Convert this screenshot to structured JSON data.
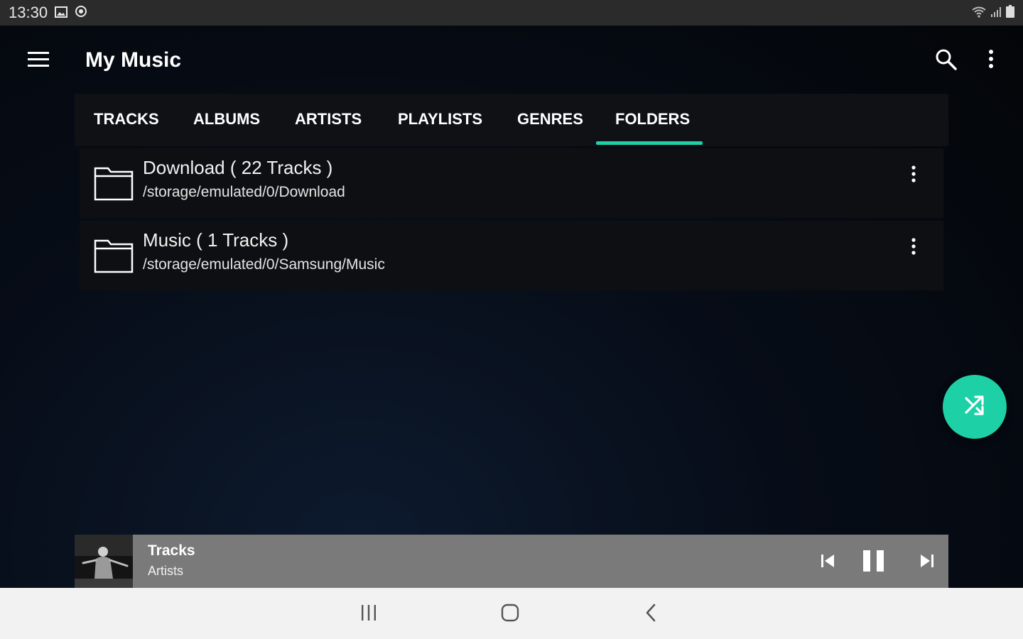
{
  "status_bar": {
    "time": "13:30",
    "left_icons": [
      "gallery-icon",
      "sync-icon"
    ],
    "right_icons": [
      "wifi-icon",
      "signal-icon",
      "battery-icon"
    ]
  },
  "app_bar": {
    "title": "My Music",
    "icons": [
      "menu-icon",
      "search-icon",
      "more-vertical-icon"
    ]
  },
  "tabs": [
    {
      "label": "TRACKS"
    },
    {
      "label": "ALBUMS"
    },
    {
      "label": "ARTISTS"
    },
    {
      "label": "PLAYLISTS"
    },
    {
      "label": "GENRES"
    },
    {
      "label": "FOLDERS",
      "selected": true
    }
  ],
  "folders": [
    {
      "name": "Download ( 22 Tracks )",
      "path": "/storage/emulated/0/Download"
    },
    {
      "name": "Music ( 1 Tracks )",
      "path": "/storage/emulated/0/Samsung/Music"
    }
  ],
  "fab": {
    "icon": "shuffle-icon"
  },
  "player": {
    "title": "Tracks",
    "artist": "Artists",
    "controls": [
      "skip-previous-icon",
      "pause-icon",
      "skip-next-icon"
    ]
  },
  "nav_bar": {
    "buttons": [
      "recents-icon",
      "home-icon",
      "back-icon"
    ]
  },
  "colors": {
    "accent": "#1ed0a6",
    "status_bar": "#2b2b2b",
    "player_bar": "#7a7a7a",
    "nav_bar": "#f2f2f2"
  }
}
